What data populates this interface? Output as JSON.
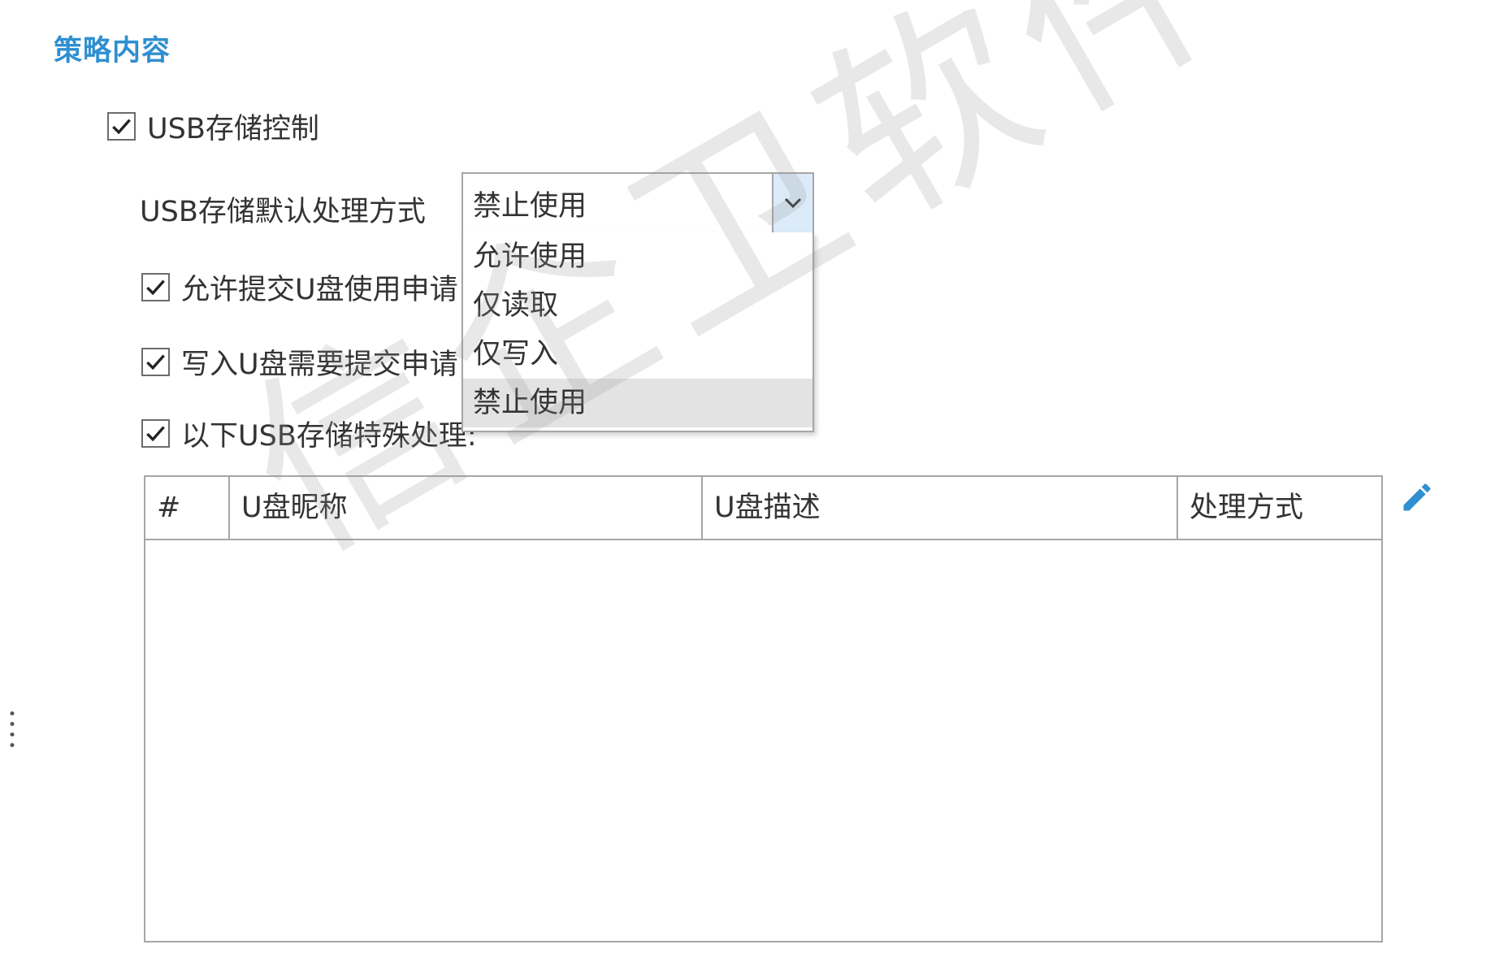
{
  "section": {
    "title": "策略内容"
  },
  "usb_control": {
    "label": "USB存储控制",
    "checked": true
  },
  "default_handling": {
    "label": "USB存储默认处理方式",
    "selected_value": "禁止使用",
    "options": [
      "允许使用",
      "仅读取",
      "仅写入",
      "禁止使用"
    ],
    "selected_index": 3
  },
  "options": [
    {
      "label": "允许提交U盘使用申请",
      "checked": true
    },
    {
      "label": "写入U盘需要提交申请",
      "checked": true
    },
    {
      "label": "以下USB存储特殊处理:",
      "checked": true
    }
  ],
  "table": {
    "columns": [
      "#",
      "U盘昵称",
      "U盘描述",
      "处理方式"
    ],
    "rows": []
  },
  "watermark": {
    "text": "信企卫软件"
  },
  "icons": {
    "check": "check-icon",
    "dropdown": "chevron-down-icon",
    "edit": "pencil-icon",
    "handle": "vertical-dots-icon"
  },
  "colors": {
    "accent": "#2f8fd1",
    "arrow_bg": "#dcebf9",
    "selected_bg": "#e3e3e3"
  }
}
